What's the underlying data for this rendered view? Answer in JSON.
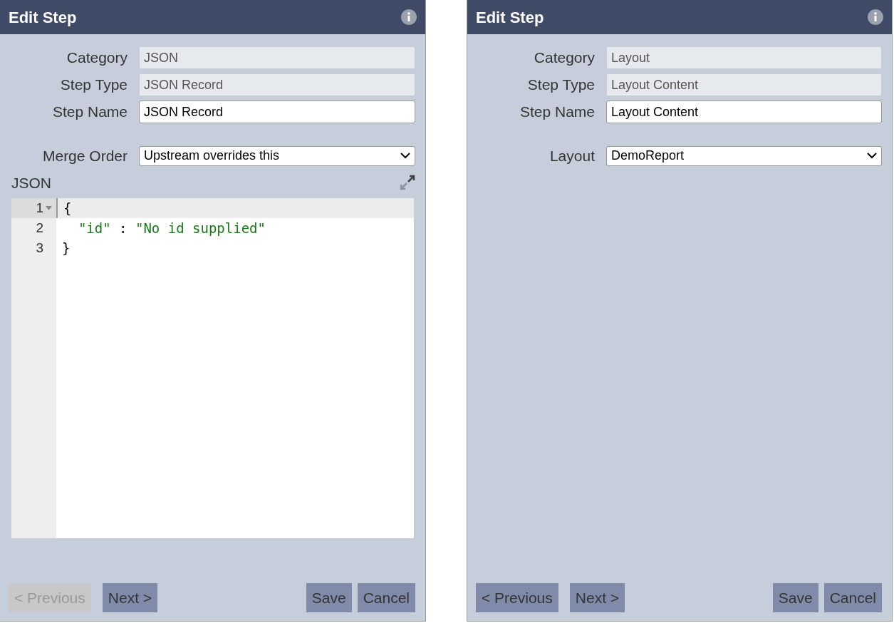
{
  "dialogs": [
    {
      "title": "Edit Step",
      "fields": [
        {
          "kind": "readonly",
          "label": "Category",
          "value": "JSON"
        },
        {
          "kind": "readonly",
          "label": "Step Type",
          "value": "JSON Record"
        },
        {
          "kind": "text",
          "label": "Step Name",
          "value": "JSON Record"
        },
        {
          "kind": "select",
          "label": "Merge Order",
          "value": "Upstream overrides this"
        }
      ],
      "editor": {
        "label": "JSON",
        "lines": [
          {
            "number": "1",
            "active": true,
            "foldable": true,
            "tokens": [
              {
                "kind": "punct",
                "text": "{"
              }
            ]
          },
          {
            "number": "2",
            "active": false,
            "foldable": false,
            "tokens": [
              {
                "kind": "string",
                "text": "  \"id\""
              },
              {
                "kind": "punct",
                "text": " : "
              },
              {
                "kind": "string",
                "text": "\"No id supplied\""
              }
            ]
          },
          {
            "number": "3",
            "active": false,
            "foldable": false,
            "tokens": [
              {
                "kind": "punct",
                "text": "}"
              }
            ]
          }
        ]
      },
      "nav_buttons": [
        {
          "label": "< Previous",
          "disabled": true
        },
        {
          "label": "Next >",
          "disabled": false
        }
      ],
      "action_buttons": [
        {
          "label": "Save",
          "disabled": false
        },
        {
          "label": "Cancel",
          "disabled": false
        }
      ]
    },
    {
      "title": "Edit Step",
      "fields": [
        {
          "kind": "readonly",
          "label": "Category",
          "value": "Layout"
        },
        {
          "kind": "readonly",
          "label": "Step Type",
          "value": "Layout Content"
        },
        {
          "kind": "text",
          "label": "Step Name",
          "value": "Layout Content"
        },
        {
          "kind": "select",
          "label": "Layout",
          "value": "DemoReport"
        }
      ],
      "nav_buttons": [
        {
          "label": "< Previous",
          "disabled": false
        },
        {
          "label": "Next >",
          "disabled": false
        }
      ],
      "action_buttons": [
        {
          "label": "Save",
          "disabled": false
        },
        {
          "label": "Cancel",
          "disabled": false
        }
      ]
    }
  ]
}
